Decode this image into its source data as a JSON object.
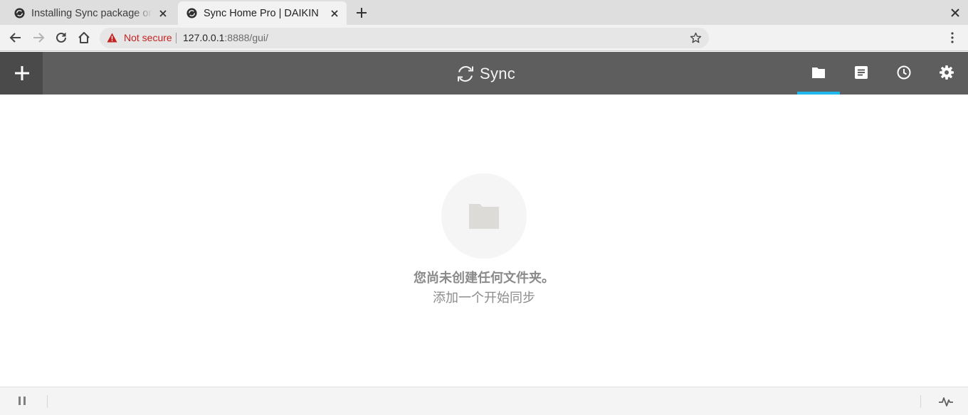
{
  "browser": {
    "tabs": [
      {
        "title": "Installing Sync package on",
        "active": false
      },
      {
        "title": "Sync Home Pro | DAIKIN",
        "active": true
      }
    ],
    "address": {
      "security_label": "Not secure",
      "host": "127.0.0.1",
      "path": ":8888/gui/"
    },
    "icons": [
      "back-icon",
      "forward-icon",
      "reload-icon",
      "home-icon",
      "warning-icon",
      "star-icon",
      "menu-icon",
      "new-tab-icon",
      "close-icon"
    ]
  },
  "app": {
    "logo_text": "Sync",
    "header_icons": [
      "add-icon",
      "folder-icon",
      "list-icon",
      "clock-icon",
      "gear-icon"
    ],
    "active_nav": "folders",
    "accent_color": "#1eb8ef",
    "header_color": "#5e5e5e"
  },
  "empty_state": {
    "title": "您尚未创建任何文件夹。",
    "subtitle": "添加一个开始同步"
  },
  "statusbar": {
    "icons": [
      "pause-icon",
      "activity-icon"
    ]
  }
}
